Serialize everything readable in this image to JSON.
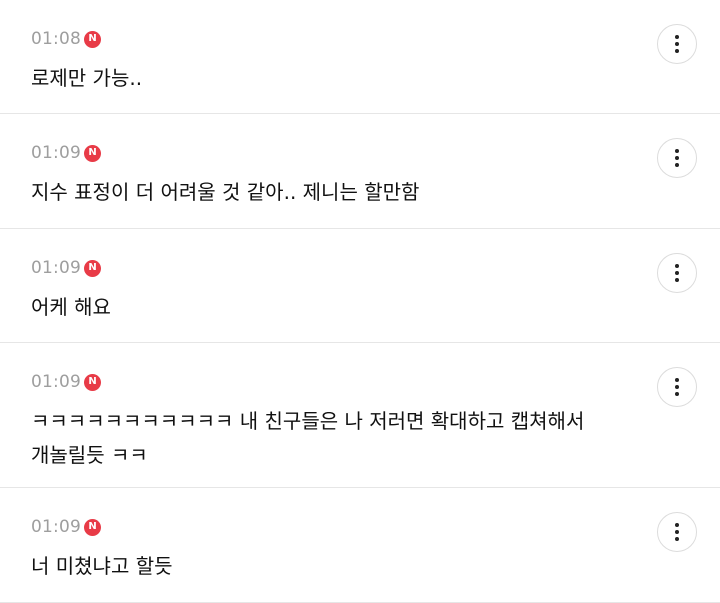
{
  "comments": [
    {
      "time": "01:08",
      "badge": "N",
      "text": "로제만 가능.."
    },
    {
      "time": "01:09",
      "badge": "N",
      "text": "지수 표정이 더 어려울 것 같아.. 제니는 할만함"
    },
    {
      "time": "01:09",
      "badge": "N",
      "text": "어케 해요"
    },
    {
      "time": "01:09",
      "badge": "N",
      "text": "ㅋㅋㅋㅋㅋㅋㅋㅋㅋㅋㅋ 내 친구들은 나 저러면 확대하고 캡쳐해서\n개놀릴듯 ㅋㅋ"
    },
    {
      "time": "01:09",
      "badge": "N",
      "text": "너 미쳤냐고 할듯"
    }
  ],
  "icons": {
    "more": "more-vertical-icon",
    "new": "new-badge-icon"
  },
  "colors": {
    "badge": "#e83b47",
    "time": "#9e9e9e",
    "divider": "#e6e6e6"
  }
}
